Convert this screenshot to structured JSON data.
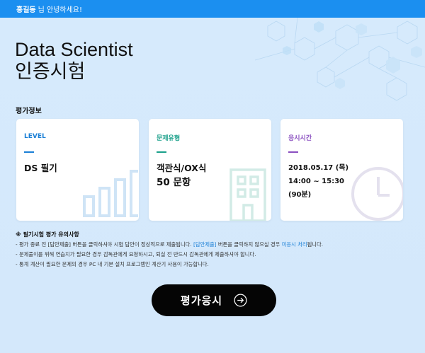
{
  "topbar": {
    "user_name": "홍길동",
    "greeting": "님 안녕하세요!"
  },
  "title": {
    "line1": "Data Scientist",
    "line2": "인증시험"
  },
  "section": {
    "label": "평가정보"
  },
  "cards": [
    {
      "label": "LEVEL",
      "value_line1": "DS 필기",
      "icon": "bar-chart-icon"
    },
    {
      "label": "문제유형",
      "value_line1": "객관식/OX식",
      "value_line2": "50 문항",
      "icon": "building-icon"
    },
    {
      "label": "응시시간",
      "value_line1": "2018.05.17 (목)",
      "value_line2": "14:00 ~ 15:30",
      "value_line3": "(90분)",
      "icon": "clock-icon"
    }
  ],
  "notes": {
    "heading": "※ 필기시험 평가 유의사항",
    "line1_pre": "- 평가 종료 전 [답안제출] 버튼을 클릭하셔야 시험 답안이 정상적으로 제출됩니다. ",
    "line1_link1": "[답안제출]",
    "line1_mid": " 버튼을 클릭하지 않으실 경우 ",
    "line1_link2": "미응시 처리",
    "line1_post": "됩니다.",
    "line2": "- 문제풀이를 위해 연습지가 필요한 경우 감독관에게 요청하시고, 퇴실 전 반드시 감독관에게 제출하셔야 합니다.",
    "line3": "- 통계 계산이 필요한 문제의 경우 PC 내 기본 설치 프로그램인 계산기 사용이 가능합니다."
  },
  "start_button": {
    "label": "평가응시",
    "icon": "arrow-right-circle-icon"
  },
  "colors": {
    "topbar": "#1b8ff0",
    "level": "#1a7fd6",
    "type": "#1aa08a",
    "time": "#8a4fc0",
    "button": "#050505"
  }
}
